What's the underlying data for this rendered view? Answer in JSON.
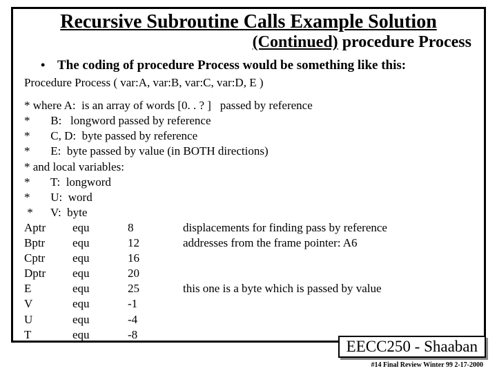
{
  "title": {
    "line1_a": "Recursive Subroutine Calls Example ",
    "line1_b": "Solution",
    "line2_a": "(Continued)",
    "line2_b": "  procedure Process"
  },
  "bullet": {
    "dot": "•",
    "text": "The coding of procedure Process would be something like this:"
  },
  "proc_sig": "Procedure Process ( var:A, var:B, var:C, var:D, E )",
  "comments": [
    "* where A:  is an array of words [0. . ? ]   passed by reference",
    "*       B:   longword passed by reference",
    "*       C, D:  byte passed by reference",
    "*       E:  byte passed by value (in BOTH directions)",
    "* and local variables:",
    "*       T:  longword",
    "*       U:  word",
    " *      V:  byte"
  ],
  "equ": [
    {
      "name": "Aptr",
      "kw": "equ",
      "val": "8",
      "note": "displacements for finding pass by reference"
    },
    {
      "name": "Bptr",
      "kw": "equ",
      "val": "12",
      "note": "addresses from the frame pointer: A6"
    },
    {
      "name": "Cptr",
      "kw": "equ",
      "val": "16",
      "note": ""
    },
    {
      "name": "Dptr",
      "kw": "equ",
      "val": "20",
      "note": ""
    },
    {
      "name": "E",
      "kw": "equ",
      "val": "25",
      "note": "this one is a byte which is passed by value"
    },
    {
      "name": "V",
      "kw": "equ",
      "val": "-1",
      "note": ""
    },
    {
      "name": "U",
      "kw": "equ",
      "val": "-4",
      "note": ""
    },
    {
      "name": "T",
      "kw": "equ",
      "val": "-8",
      "note": ""
    }
  ],
  "footer": {
    "box": "EECC250 - Shaaban",
    "note": "#14  Final Review  Winter 99   2-17-2000"
  }
}
